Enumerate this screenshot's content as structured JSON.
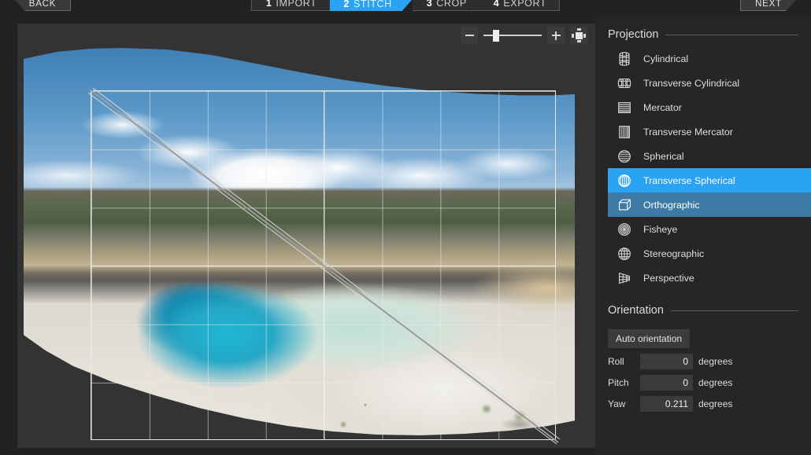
{
  "topbar": {
    "back_label": "BACK",
    "next_label": "NEXT",
    "steps": [
      {
        "num": "1",
        "label": "IMPORT",
        "active": false
      },
      {
        "num": "2",
        "label": "STITCH",
        "active": true
      },
      {
        "num": "3",
        "label": "CROP",
        "active": false
      },
      {
        "num": "4",
        "label": "EXPORT",
        "active": false
      }
    ]
  },
  "toolbar": {
    "zoom_out_icon": "minus-icon",
    "zoom_in_icon": "plus-icon",
    "fit_icon": "fit-to-screen-icon",
    "zoom_slider_value": 22
  },
  "canvas": {
    "image_description": "Stitched panorama of a turquoise Yellowstone hot spring with white mineral terraces, forested ridge and cumulus clouds",
    "grid_visible": true,
    "crop_rect_visible": true
  },
  "panel": {
    "projection": {
      "title": "Projection",
      "items": [
        {
          "label": "Cylindrical",
          "icon": "cylinder-grid-icon",
          "state": "normal"
        },
        {
          "label": "Transverse Cylindrical",
          "icon": "cylinder-horizontal-icon",
          "state": "normal"
        },
        {
          "label": "Mercator",
          "icon": "horizontal-lines-icon",
          "state": "normal"
        },
        {
          "label": "Transverse Mercator",
          "icon": "vertical-lines-icon",
          "state": "normal"
        },
        {
          "label": "Spherical",
          "icon": "sphere-latitude-icon",
          "state": "normal"
        },
        {
          "label": "Transverse Spherical",
          "icon": "sphere-longitude-icon",
          "state": "hover"
        },
        {
          "label": "Orthographic",
          "icon": "cube-icon",
          "state": "selected"
        },
        {
          "label": "Fisheye",
          "icon": "concentric-circles-icon",
          "state": "normal"
        },
        {
          "label": "Stereographic",
          "icon": "globe-grid-icon",
          "state": "normal"
        },
        {
          "label": "Perspective",
          "icon": "frustum-icon",
          "state": "normal"
        }
      ]
    },
    "orientation": {
      "title": "Orientation",
      "auto_button": "Auto orientation",
      "fields": [
        {
          "label": "Roll",
          "value": "0",
          "unit": "degrees"
        },
        {
          "label": "Pitch",
          "value": "0",
          "unit": "degrees"
        },
        {
          "label": "Yaw",
          "value": "0.211",
          "unit": "degrees"
        }
      ]
    }
  },
  "colors": {
    "accent_hover": "#2aa3f2",
    "accent_selected": "#3d7ba6",
    "panel_bg": "#262626",
    "canvas_bg": "#333333",
    "window_bg": "#222222"
  }
}
